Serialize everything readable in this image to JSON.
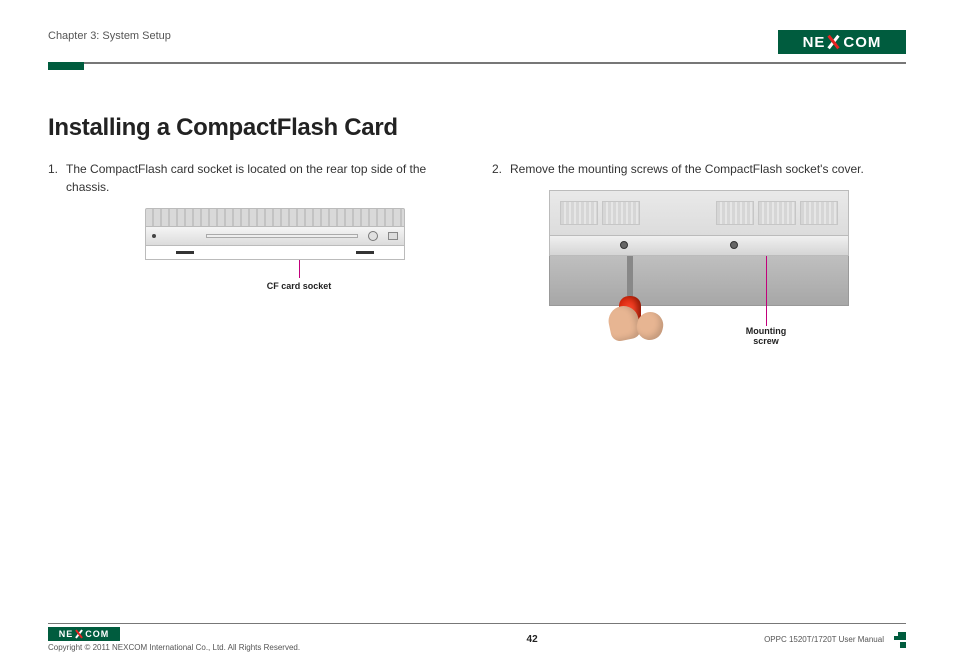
{
  "header": {
    "chapter": "Chapter 3: System Setup",
    "logo_left": "NE",
    "logo_right": "COM"
  },
  "main": {
    "heading": "Installing a CompactFlash Card",
    "step1_num": "1.",
    "step1_text": "The CompactFlash card socket is located on the rear top side of the chassis.",
    "step2_num": "2.",
    "step2_text": "Remove the mounting screws of the CompactFlash socket's cover.",
    "callout_left": "CF card socket",
    "callout_right_l1": "Mounting",
    "callout_right_l2": "screw"
  },
  "footer": {
    "copyright": "Copyright © 2011 NEXCOM International Co., Ltd. All Rights Reserved.",
    "page": "42",
    "manual": "OPPC 1520T/1720T User Manual",
    "logo_left": "NE",
    "logo_right": "COM"
  }
}
